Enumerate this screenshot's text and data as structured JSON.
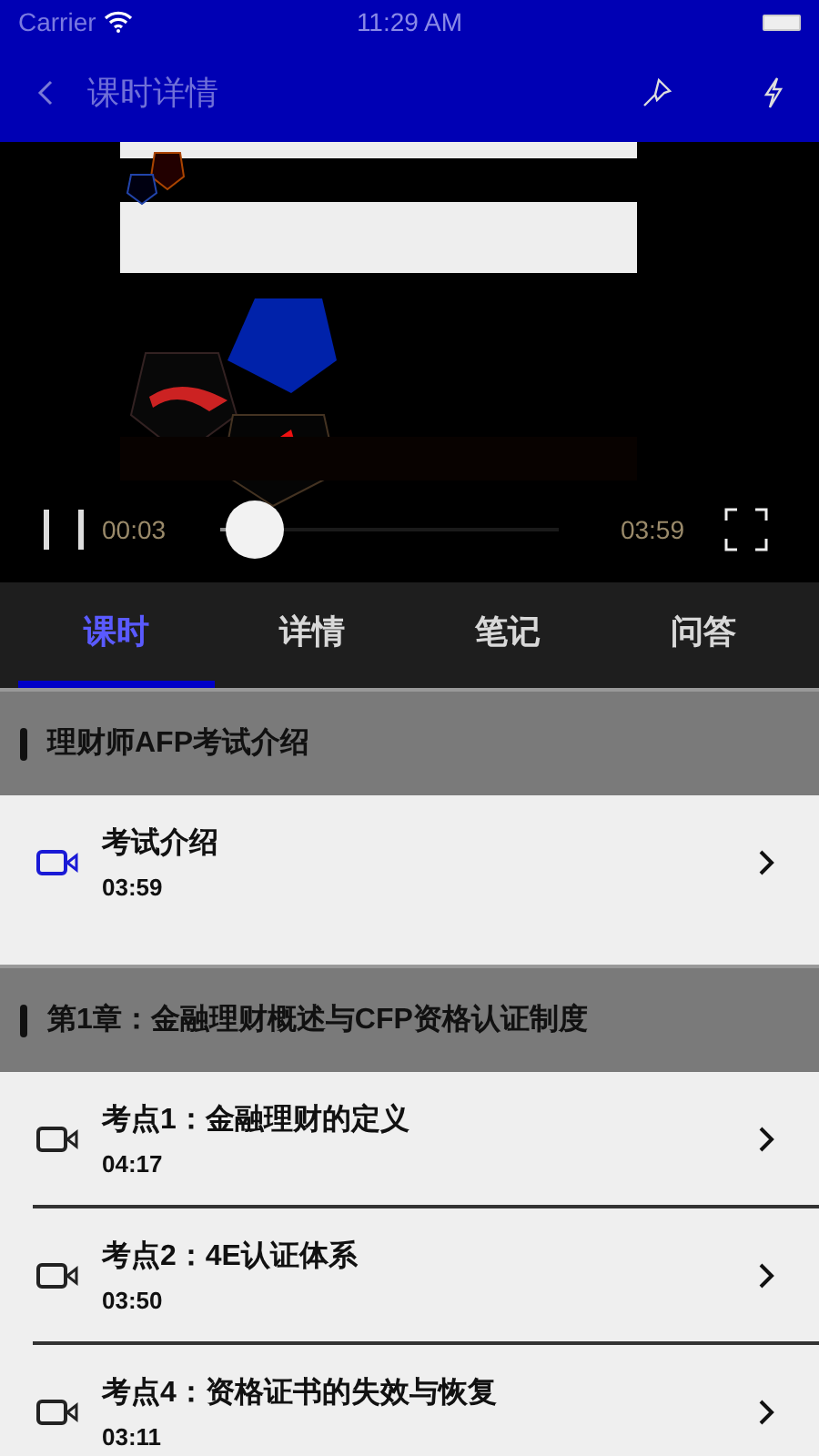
{
  "status_bar": {
    "carrier": "Carrier",
    "time": "11:29 AM"
  },
  "nav": {
    "title": "课时详情"
  },
  "player": {
    "playing": true,
    "elapsed": "00:03",
    "duration": "03:59",
    "level": 0.02
  },
  "tabs": [
    {
      "label": "课时",
      "selected": true
    },
    {
      "label": "详情",
      "selected": false
    },
    {
      "label": "笔记",
      "selected": false
    },
    {
      "label": "问答",
      "selected": false
    }
  ],
  "sections": [
    {
      "title": "理财师AFP考试介绍",
      "lessons": [
        {
          "title": "考试介绍",
          "time": "03:59",
          "selected": true
        }
      ]
    },
    {
      "title": "第1章：金融理财概述与CFP资格认证制度",
      "lessons": [
        {
          "title": "考点1：金融理财的定义",
          "time": "04:17",
          "selected": false
        },
        {
          "title": "考点2：4E认证体系",
          "time": "03:50",
          "selected": false
        },
        {
          "title": "考点4：资格证书的失效与恢复",
          "time": "03:11",
          "selected": false
        }
      ]
    }
  ]
}
